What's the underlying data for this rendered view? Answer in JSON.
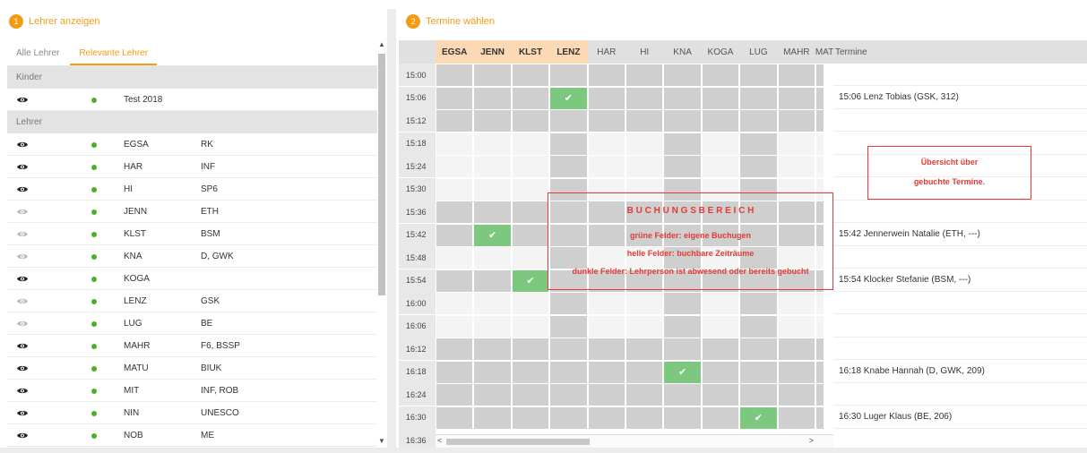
{
  "left_section": {
    "num": "1",
    "title": "Lehrer anzeigen"
  },
  "right_section": {
    "num": "2",
    "title": "Termine wählen"
  },
  "tabs": [
    {
      "label": "Alle Lehrer",
      "active": false
    },
    {
      "label": "Relevante Lehrer",
      "active": true
    }
  ],
  "groups": {
    "kinder": "Kinder",
    "lehrer": "Lehrer"
  },
  "kinder": [
    {
      "abbr": "Test 2018",
      "subj": "",
      "eye": "dark"
    }
  ],
  "lehrer": [
    {
      "abbr": "EGSA",
      "subj": "RK",
      "eye": "dark"
    },
    {
      "abbr": "HAR",
      "subj": "INF",
      "eye": "dark"
    },
    {
      "abbr": "HI",
      "subj": "SP6",
      "eye": "dark"
    },
    {
      "abbr": "JENN",
      "subj": "ETH",
      "eye": "light"
    },
    {
      "abbr": "KLST",
      "subj": "BSM",
      "eye": "light"
    },
    {
      "abbr": "KNA",
      "subj": "D, GWK",
      "eye": "light"
    },
    {
      "abbr": "KOGA",
      "subj": "",
      "eye": "dark"
    },
    {
      "abbr": "LENZ",
      "subj": "GSK",
      "eye": "light"
    },
    {
      "abbr": "LUG",
      "subj": "BE",
      "eye": "light"
    },
    {
      "abbr": "MAHR",
      "subj": "F6, BSSP",
      "eye": "dark"
    },
    {
      "abbr": "MATU",
      "subj": "BIUK",
      "eye": "dark"
    },
    {
      "abbr": "MIT",
      "subj": "INF, ROB",
      "eye": "dark"
    },
    {
      "abbr": "NIN",
      "subj": "UNESCO",
      "eye": "dark"
    },
    {
      "abbr": "NOB",
      "subj": "ME",
      "eye": "dark"
    }
  ],
  "columns": [
    {
      "label": "EGSA",
      "hl": true
    },
    {
      "label": "JENN",
      "hl": true
    },
    {
      "label": "KLST",
      "hl": true
    },
    {
      "label": "LENZ",
      "hl": true
    },
    {
      "label": "HAR",
      "hl": false
    },
    {
      "label": "HI",
      "hl": false
    },
    {
      "label": "KNA",
      "hl": false
    },
    {
      "label": "KOGA",
      "hl": false
    },
    {
      "label": "LUG",
      "hl": false
    },
    {
      "label": "MAHR",
      "hl": false
    },
    {
      "label": "MAT",
      "hl": false
    }
  ],
  "termine_header": "Termine",
  "times": [
    "15:00",
    "15:06",
    "15:12",
    "15:18",
    "15:24",
    "15:30",
    "15:36",
    "15:42",
    "15:48",
    "15:54",
    "16:00",
    "16:06",
    "16:12",
    "16:18",
    "16:24",
    "16:30",
    "16:36"
  ],
  "grid": [
    "DDDDDDDDDDD",
    "DDDGDDDDDDD",
    "DDDDDDDDDDD",
    "LLLDLLDLDLL",
    "LLLDLLDLDLL",
    "LLLDLLDLDLL",
    "DDDDDDDDDDD",
    "DGDDDDDDDDD",
    "LLLDLLDLDLL",
    "DDGDDDDDDDD",
    "LLLDLLDLDLL",
    "LLLDLLDLDLL",
    "DDDDDDDDDDD",
    "DDDDDDGDDDD",
    "DDDDDDDDDDD",
    "DDDDDDDDGDD",
    "DDDDDDDDDDD"
  ],
  "termine": [
    "",
    "15:06 Lenz Tobias (GSK, 312)",
    "",
    "",
    "",
    "",
    "",
    "15:42 Jennerwein Natalie (ETH, ---)",
    "",
    "15:54 Klocker Stefanie (BSM, ---)",
    "",
    "",
    "",
    "16:18 Knabe Hannah (D, GWK, 209)",
    "",
    "16:30 Luger Klaus (BE, 206)",
    ""
  ],
  "annotation_main": {
    "title": "B U C H U N G S B E R E I C H",
    "line1": "grüne Felder: eigene Buchugen",
    "line2": "helle Felder: buchbare Zeiträume",
    "line3": "dunkle Felder: Lehrperson ist abwesend oder bereits gebucht"
  },
  "annotation_side": {
    "line1": "Übersicht über",
    "line2": "gebuchte Termine."
  },
  "colors": {
    "accent": "#f39c12",
    "green": "#7cc87f",
    "dark_cell": "#cfcfcf",
    "light_cell": "#f4f4f4",
    "annotation": "#e53935",
    "online_dot": "#4caf2a"
  }
}
